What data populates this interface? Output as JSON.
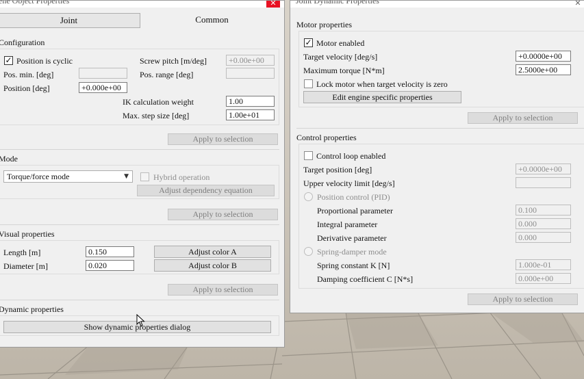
{
  "left": {
    "title": "ene Object Properties",
    "close_glyph": "✕",
    "tabs": [
      "Joint",
      "Common"
    ],
    "configuration": {
      "heading": "Configuration",
      "cyclic_label": "Position is cyclic",
      "cyclic_checked": true,
      "pos_min_label": "Pos. min. [deg]",
      "pos_min_value": "",
      "position_label": "Position [deg]",
      "position_value": "+0.000e+00",
      "screw_pitch_label": "Screw pitch [m/deg]",
      "screw_pitch_value": "+0.00e+00",
      "pos_range_label": "Pos. range [deg]",
      "pos_range_value": "",
      "ik_weight_label": "IK calculation weight",
      "ik_weight_value": "1.00",
      "max_step_label": "Max. step size [deg]",
      "max_step_value": "1.00e+01",
      "apply": "Apply to selection"
    },
    "mode": {
      "heading": "Mode",
      "selected": "Torque/force mode",
      "hybrid_label": "Hybrid operation",
      "adjust_dep": "Adjust dependency equation",
      "apply": "Apply to selection"
    },
    "visual": {
      "heading": "Visual properties",
      "length_label": "Length [m]",
      "length_value": "0.150",
      "diameter_label": "Diameter [m]",
      "diameter_value": "0.020",
      "color_a": "Adjust color A",
      "color_b": "Adjust color B",
      "apply": "Apply to selection"
    },
    "dynamic": {
      "heading": "Dynamic properties",
      "show_dialog": "Show dynamic properties dialog"
    }
  },
  "right": {
    "title": "Joint Dynamic Properties",
    "close_glyph": "✕",
    "motor": {
      "heading": "Motor properties",
      "enabled_label": "Motor enabled",
      "enabled_checked": true,
      "target_vel_label": "Target velocity [deg/s]",
      "target_vel_value": "+0.0000e+00",
      "max_torque_label": "Maximum torque [N*m]",
      "max_torque_value": "2.5000e+00",
      "lock_label": "Lock motor when target velocity is zero",
      "edit_engine": "Edit engine specific properties",
      "apply": "Apply to selection"
    },
    "control": {
      "heading": "Control properties",
      "loop_label": "Control loop enabled",
      "target_pos_label": "Target position [deg]",
      "target_pos_value": "+0.0000e+00",
      "upper_vel_label": "Upper velocity limit [deg/s]",
      "upper_vel_value": "",
      "pid_label": "Position control (PID)",
      "prop_label": "Proportional parameter",
      "prop_value": "0.100",
      "integral_label": "Integral parameter",
      "integral_value": "0.000",
      "deriv_label": "Derivative parameter",
      "deriv_value": "0.000",
      "spring_label": "Spring-damper mode",
      "spring_k_label": "Spring constant K [N]",
      "spring_k_value": "1.000e-01",
      "damping_label": "Damping coefficient C [N*s]",
      "damping_value": "0.000e+00",
      "apply": "Apply to selection"
    }
  }
}
